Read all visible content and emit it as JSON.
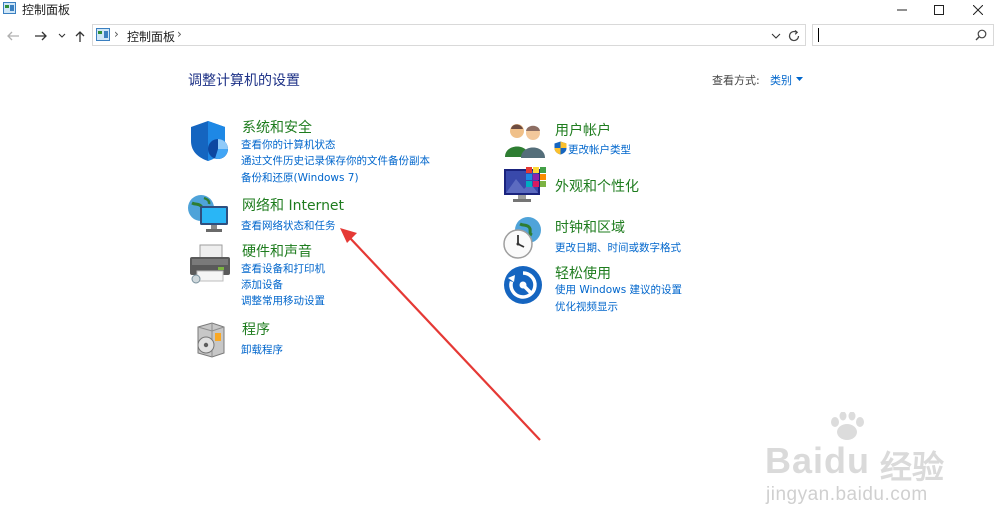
{
  "window": {
    "title": "控制面板"
  },
  "address": {
    "breadcrumb": "控制面板"
  },
  "search": {
    "placeholder": ""
  },
  "header": {
    "title": "调整计算机的设置",
    "view_by_label": "查看方式:",
    "view_by_value": "类别"
  },
  "categories": [
    {
      "title": "系统和安全",
      "links": [
        "查看你的计算机状态",
        "通过文件历史记录保存你的文件备份副本",
        "备份和还原(Windows 7)"
      ]
    },
    {
      "title": "网络和 Internet",
      "links": [
        "查看网络状态和任务"
      ]
    },
    {
      "title": "硬件和声音",
      "links": [
        "查看设备和打印机",
        "添加设备",
        "调整常用移动设置"
      ]
    },
    {
      "title": "程序",
      "links": [
        "卸载程序"
      ]
    },
    {
      "title": "用户帐户",
      "links": [
        "更改帐户类型"
      ]
    },
    {
      "title": "外观和个性化",
      "links": []
    },
    {
      "title": "时钟和区域",
      "links": [
        "更改日期、时间或数字格式"
      ]
    },
    {
      "title": "轻松使用",
      "links": [
        "使用 Windows 建议的设置",
        "优化视频显示"
      ]
    }
  ],
  "watermark": {
    "brand_a": "Bai",
    "brand_b": "du",
    "brand_cn": "经验",
    "url": "jingyan.baidu.com"
  },
  "colors": {
    "title_blue": "#1e3287",
    "category_green": "#1e7c1e",
    "link_blue": "#0066cc",
    "arrow_red": "#e53935"
  }
}
